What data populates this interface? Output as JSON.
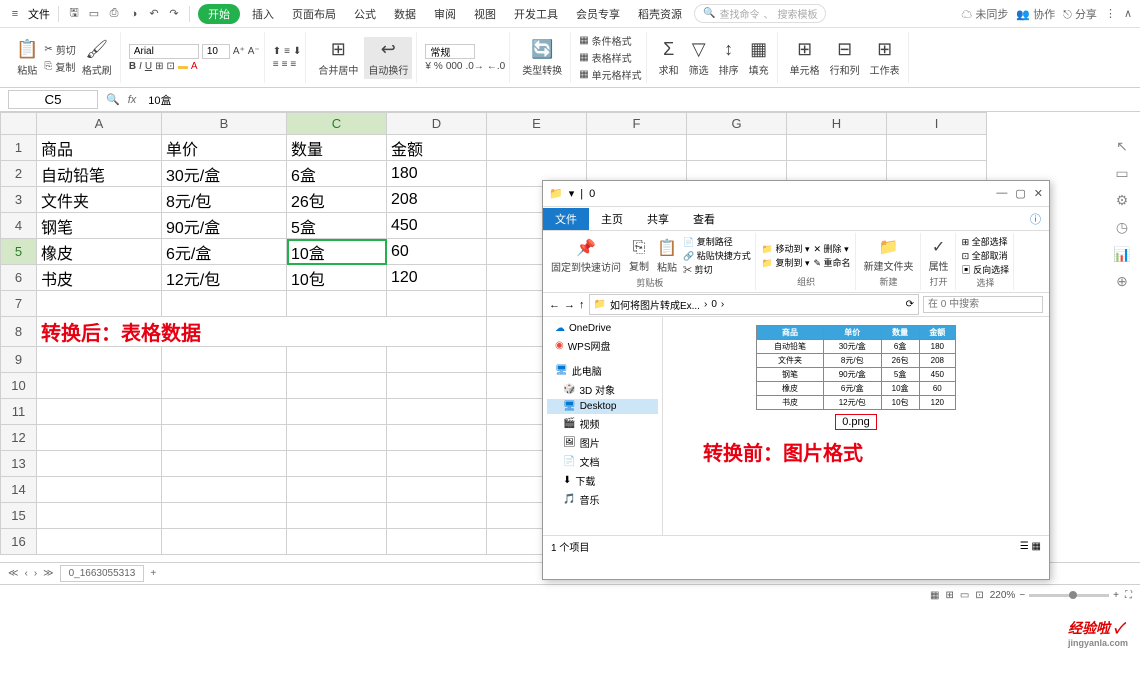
{
  "menubar": {
    "file": "文件",
    "tabs": [
      "开始",
      "插入",
      "页面布局",
      "公式",
      "数据",
      "审阅",
      "视图",
      "开发工具",
      "会员专享",
      "稻壳资源"
    ],
    "search_hint1": "查找命令",
    "search_hint2": "搜索模板",
    "right": {
      "unsync": "未同步",
      "coop": "协作",
      "share": "分享"
    }
  },
  "ribbon": {
    "paste": "粘贴",
    "cut": "剪切",
    "copy": "复制",
    "format_painter": "格式刷",
    "font": "Arial",
    "font_size": "10",
    "merge": "合并居中",
    "wrap": "自动换行",
    "numfmt": "常规",
    "type_convert": "类型转换",
    "cond_fmt": "条件格式",
    "table_style": "表格样式",
    "cell_style": "单元格样式",
    "sum": "求和",
    "filter": "筛选",
    "sort": "排序",
    "fill": "填充",
    "cell": "单元格",
    "row_col": "行和列",
    "worksheet": "工作表"
  },
  "formula": {
    "cell_ref": "C5",
    "value": "10盒"
  },
  "columns": [
    "A",
    "B",
    "C",
    "D",
    "E",
    "F",
    "G",
    "H",
    "I"
  ],
  "rows": [
    {
      "n": "1",
      "a": "商品",
      "b": "单价",
      "c": "数量",
      "d": "金额"
    },
    {
      "n": "2",
      "a": "自动铅笔",
      "b": "30元/盒",
      "c": "6盒",
      "d": "180"
    },
    {
      "n": "3",
      "a": "文件夹",
      "b": "8元/包",
      "c": "26包",
      "d": "208"
    },
    {
      "n": "4",
      "a": "钢笔",
      "b": "90元/盒",
      "c": "5盒",
      "d": "450"
    },
    {
      "n": "5",
      "a": "橡皮",
      "b": "6元/盒",
      "c": "10盒",
      "d": "60"
    },
    {
      "n": "6",
      "a": "书皮",
      "b": "12元/包",
      "c": "10包",
      "d": "120"
    }
  ],
  "annotation_after": "转换后：表格数据",
  "annotation_before": "转换前：图片格式",
  "sheet_tab": "0_1663055313",
  "status": {
    "zoom": "220%"
  },
  "explorer": {
    "title": "0",
    "tabs": {
      "file": "文件",
      "home": "主页",
      "share": "共享",
      "view": "查看"
    },
    "ribbon": {
      "pin": "固定到快速访问",
      "copy": "复制",
      "paste": "粘贴",
      "copy_path": "复制路径",
      "paste_shortcut": "粘贴快捷方式",
      "cut": "剪切",
      "move_to": "移动到",
      "copy_to": "复制到",
      "delete": "删除",
      "rename": "重命名",
      "new_folder": "新建文件夹",
      "properties": "属性",
      "select_all": "全部选择",
      "select_none": "全部取消",
      "invert": "反向选择",
      "g_clipboard": "剪贴板",
      "g_organize": "组织",
      "g_new": "新建",
      "g_open": "打开",
      "g_select": "选择"
    },
    "path": {
      "crumb1": "如何将图片转成Ex...",
      "crumb2": "0",
      "search_hint": "在 0 中搜索"
    },
    "nav": {
      "onedrive": "OneDrive",
      "wps": "WPS网盘",
      "thispc": "此电脑",
      "objects3d": "3D 对象",
      "desktop": "Desktop",
      "videos": "视频",
      "pictures": "图片",
      "documents": "文档",
      "downloads": "下载",
      "music": "音乐"
    },
    "thumb": {
      "headers": [
        "商品",
        "单价",
        "数量",
        "金额"
      ],
      "rows": [
        [
          "自动铅笔",
          "30元/盒",
          "6盒",
          "180"
        ],
        [
          "文件夹",
          "8元/包",
          "26包",
          "208"
        ],
        [
          "钢笔",
          "90元/盒",
          "5盒",
          "450"
        ],
        [
          "橡皮",
          "6元/盒",
          "10盒",
          "60"
        ],
        [
          "书皮",
          "12元/包",
          "10包",
          "120"
        ]
      ],
      "filename": "0.png"
    },
    "status": "1 个项目"
  },
  "watermark": {
    "main": "经验啦 ✓",
    "sub": "jingyanla.com"
  }
}
